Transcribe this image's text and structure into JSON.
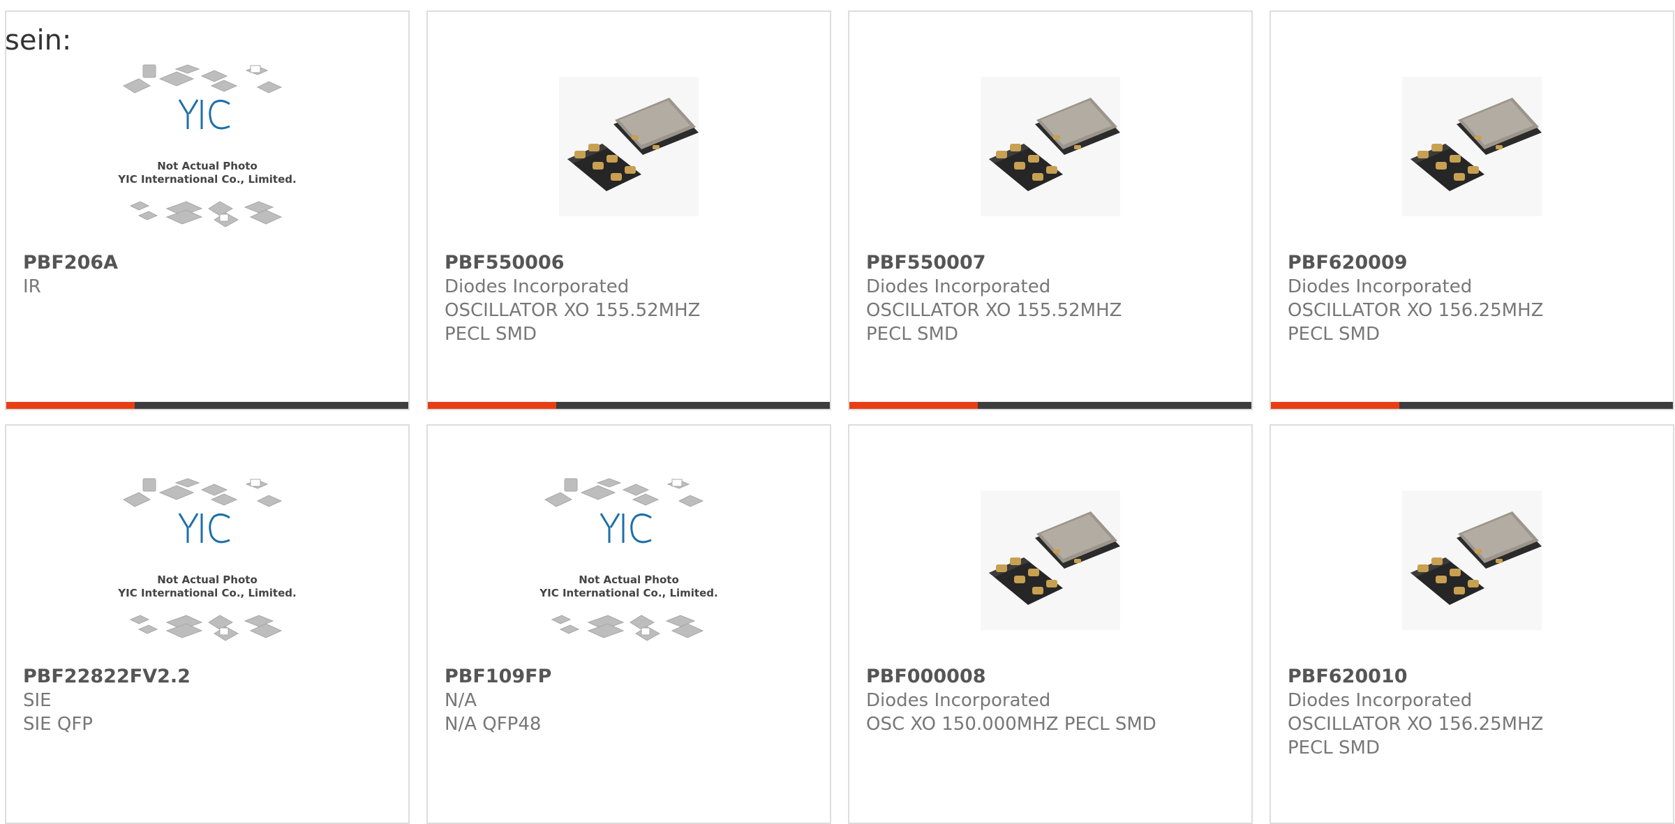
{
  "heading": "sein:",
  "placeholder": {
    "caption_line1": "Not Actual Photo",
    "caption_line2": "YIC International Co., Limited.",
    "logo": "YIC"
  },
  "colors": {
    "accent": "#e83e16",
    "bar_track": "#3d3d3d",
    "card_border": "#dddddd"
  },
  "products": [
    {
      "part": "PBF206A",
      "manufacturer": "IR",
      "desc1": "",
      "desc2": "",
      "image": "yic-placeholder",
      "progress": 0.32
    },
    {
      "part": "PBF550006",
      "manufacturer": "Diodes Incorporated",
      "desc1": "OSCILLATOR XO 155.52MHZ",
      "desc2": "PECL SMD",
      "image": "crystal-oscillator",
      "progress": 0.32
    },
    {
      "part": "PBF550007",
      "manufacturer": "Diodes Incorporated",
      "desc1": "OSCILLATOR XO 155.52MHZ",
      "desc2": "PECL SMD",
      "image": "crystal-oscillator",
      "progress": 0.32
    },
    {
      "part": "PBF620009",
      "manufacturer": "Diodes Incorporated",
      "desc1": "OSCILLATOR XO 156.25MHZ",
      "desc2": "PECL SMD",
      "image": "crystal-oscillator",
      "progress": 0.32
    },
    {
      "part": "PBF22822FV2.2",
      "manufacturer": "SIE",
      "desc1": "SIE QFP",
      "desc2": "",
      "image": "yic-placeholder"
    },
    {
      "part": "PBF109FP",
      "manufacturer": "N/A",
      "desc1": "N/A QFP48",
      "desc2": "",
      "image": "yic-placeholder"
    },
    {
      "part": "PBF000008",
      "manufacturer": "Diodes Incorporated",
      "desc1": "OSC XO 150.000MHZ PECL SMD",
      "desc2": "",
      "image": "crystal-oscillator"
    },
    {
      "part": "PBF620010",
      "manufacturer": "Diodes Incorporated",
      "desc1": "OSCILLATOR XO 156.25MHZ",
      "desc2": "PECL SMD",
      "image": "crystal-oscillator"
    }
  ]
}
